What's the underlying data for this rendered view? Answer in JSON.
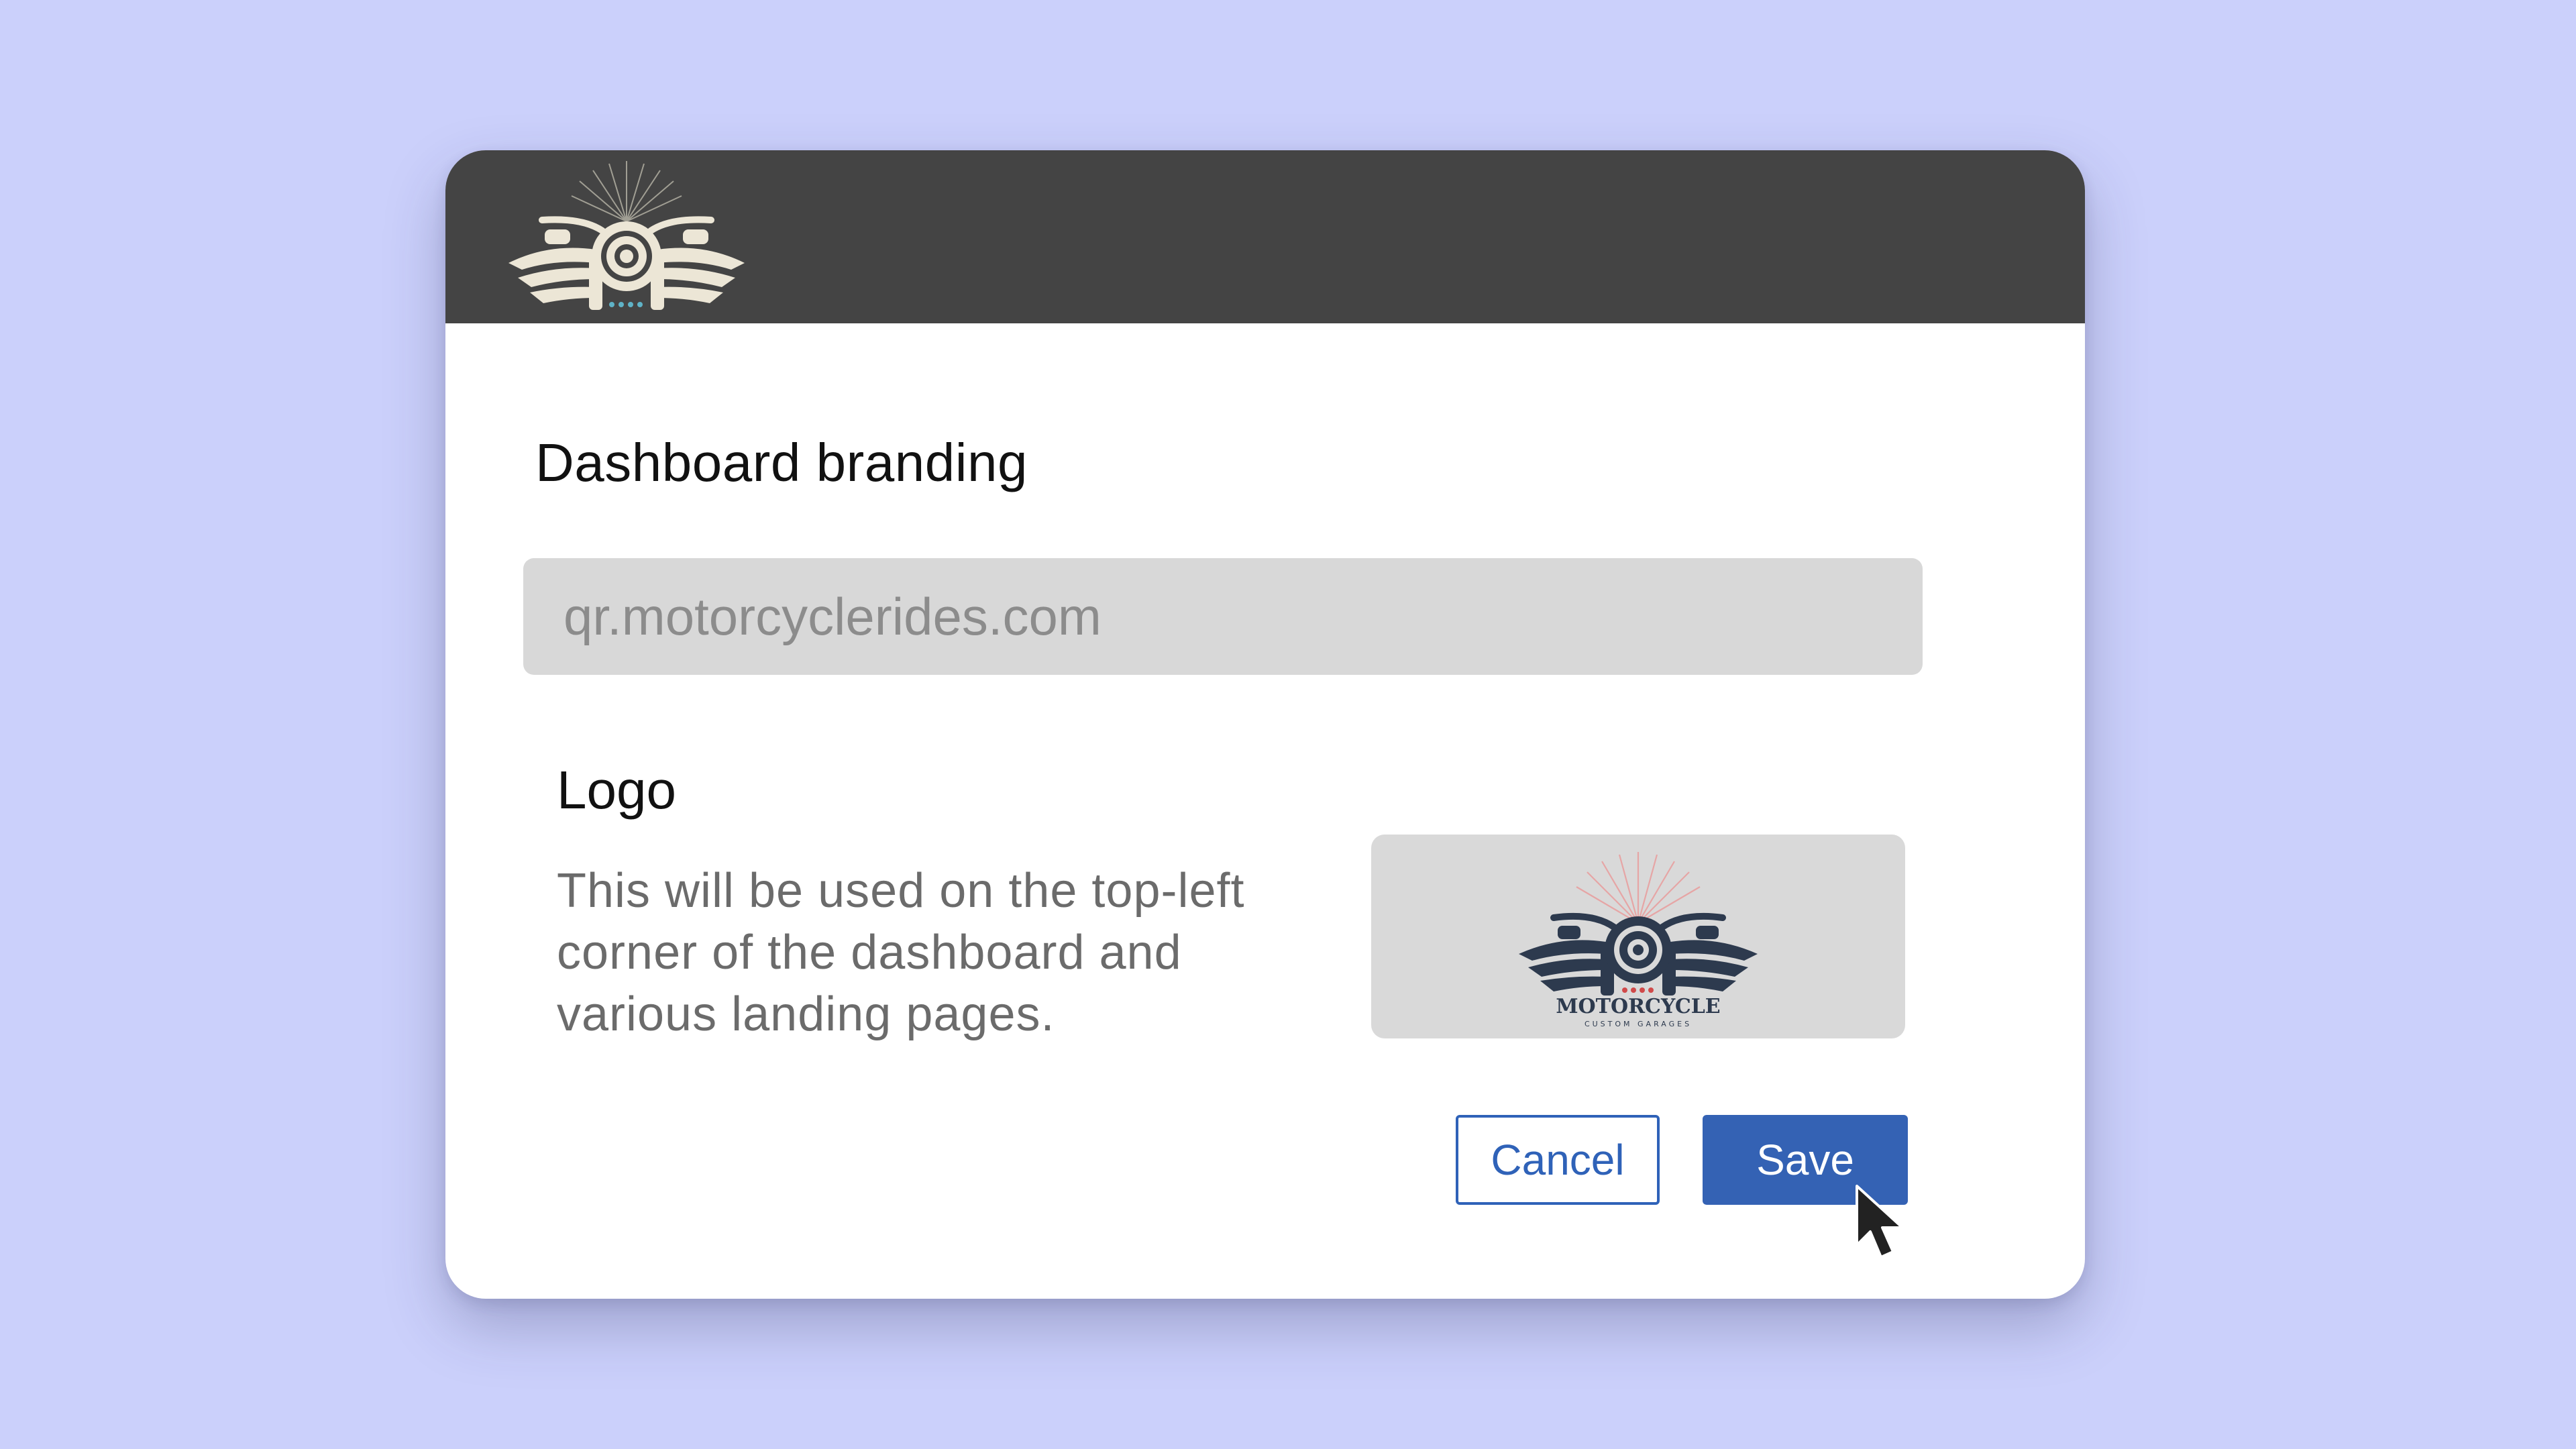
{
  "header": {
    "logo_icon": "motorcycle-emblem-icon"
  },
  "branding": {
    "title": "Dashboard branding",
    "domain_value": "",
    "domain_placeholder": "qr.motorcyclerides.com"
  },
  "logo": {
    "title": "Logo",
    "description": "This will be used on the top-left corner of the dashboard and various landing pages.",
    "preview": {
      "icon": "motorcycle-emblem-icon",
      "brand_text": "MOTORCYCLE",
      "brand_subtext": "CUSTOM GARAGES"
    }
  },
  "actions": {
    "cancel_label": "Cancel",
    "save_label": "Save"
  },
  "colors": {
    "background": "#cbd0fb",
    "header": "#444444",
    "accent": "#3462b4",
    "input_bg": "#d8d8d8"
  }
}
